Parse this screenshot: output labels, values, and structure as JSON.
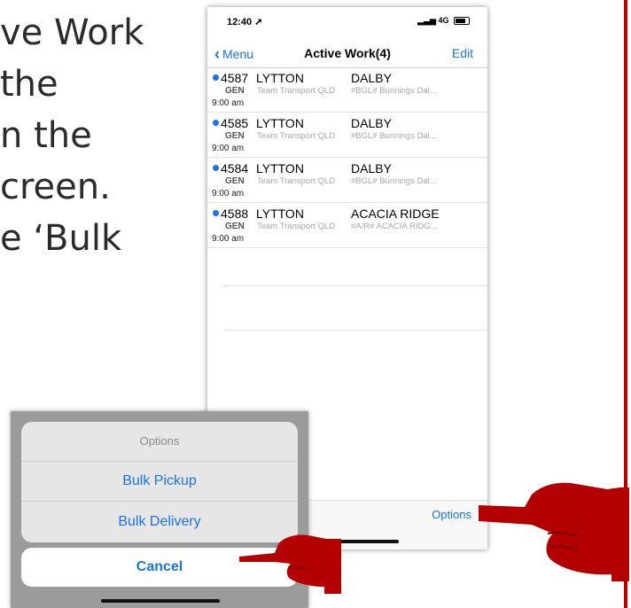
{
  "slide": {
    "lines": [
      "ve Work",
      " the",
      "n the",
      "creen.",
      "e ‘Bulk"
    ]
  },
  "phone": {
    "status": {
      "time": "12:40",
      "network": "4G"
    },
    "nav": {
      "back_label": "Menu",
      "title": "Active Work(4)",
      "edit_label": "Edit"
    },
    "rows": [
      {
        "number": "4587",
        "from": "LYTTON",
        "to": "DALBY",
        "type": "GEN",
        "carrier": "Team Transport QLD",
        "reference": "#BGL# Bunnings Dal...",
        "time": "9:00 am"
      },
      {
        "number": "4585",
        "from": "LYTTON",
        "to": "DALBY",
        "type": "GEN",
        "carrier": "Team Transport QLD",
        "reference": "#BGL# Bunnings Dal...",
        "time": "9:00 am"
      },
      {
        "number": "4584",
        "from": "LYTTON",
        "to": "DALBY",
        "type": "GEN",
        "carrier": "Team Transport QLD",
        "reference": "#BGL# Bunnings Dal...",
        "time": "9:00 am"
      },
      {
        "number": "4588",
        "from": "LYTTON",
        "to": "ACACIA RIDGE",
        "type": "GEN",
        "carrier": "Team Transport QLD",
        "reference": "#A/R# ACACIA RIDG...",
        "time": "9:00 am"
      }
    ],
    "toolbar": {
      "options_label": "Options"
    }
  },
  "sheet": {
    "title": "Options",
    "option1": "Bulk Pickup",
    "option2": "Bulk Delivery",
    "cancel": "Cancel"
  },
  "colors": {
    "accent": "#1a73e8",
    "pointer": "#b30000"
  }
}
